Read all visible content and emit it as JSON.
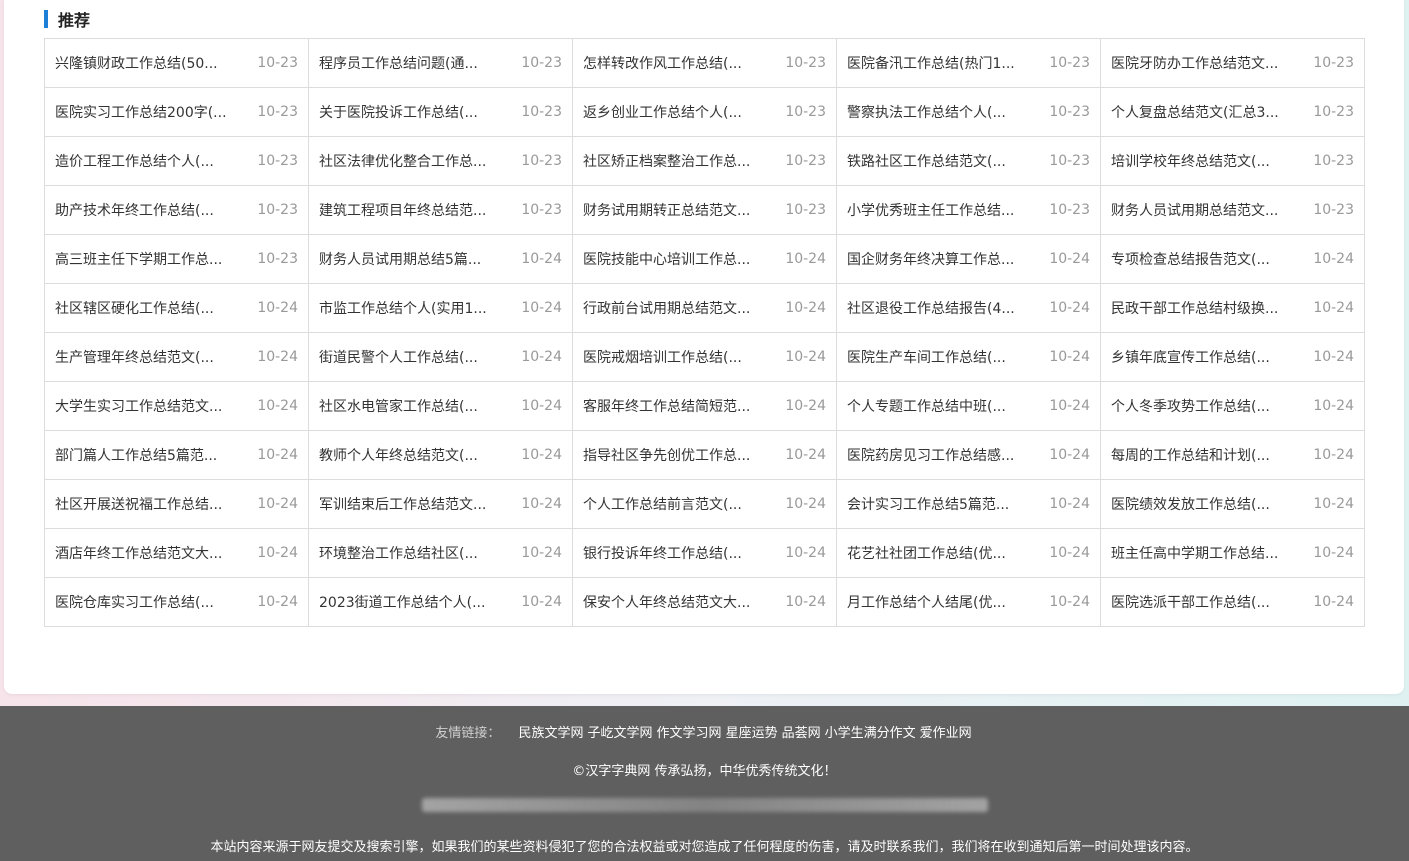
{
  "section": {
    "title": "推荐"
  },
  "articles": [
    {
      "title": "兴隆镇财政工作总结(50...",
      "date": "10-23"
    },
    {
      "title": "程序员工作总结问题(通...",
      "date": "10-23"
    },
    {
      "title": "怎样转改作风工作总结(...",
      "date": "10-23"
    },
    {
      "title": "医院备汛工作总结(热门1...",
      "date": "10-23"
    },
    {
      "title": "医院牙防办工作总结范文...",
      "date": "10-23"
    },
    {
      "title": "医院实习工作总结200字(...",
      "date": "10-23"
    },
    {
      "title": "关于医院投诉工作总结(...",
      "date": "10-23"
    },
    {
      "title": "返乡创业工作总结个人(...",
      "date": "10-23"
    },
    {
      "title": "警察执法工作总结个人(...",
      "date": "10-23"
    },
    {
      "title": "个人复盘总结范文(汇总3...",
      "date": "10-23"
    },
    {
      "title": "造价工程工作总结个人(...",
      "date": "10-23"
    },
    {
      "title": "社区法律优化整合工作总...",
      "date": "10-23"
    },
    {
      "title": "社区矫正档案整治工作总...",
      "date": "10-23"
    },
    {
      "title": "铁路社区工作总结范文(...",
      "date": "10-23"
    },
    {
      "title": "培训学校年终总结范文(...",
      "date": "10-23"
    },
    {
      "title": "助产技术年终工作总结(...",
      "date": "10-23"
    },
    {
      "title": "建筑工程项目年终总结范...",
      "date": "10-23"
    },
    {
      "title": "财务试用期转正总结范文...",
      "date": "10-23"
    },
    {
      "title": "小学优秀班主任工作总结...",
      "date": "10-23"
    },
    {
      "title": "财务人员试用期总结范文...",
      "date": "10-23"
    },
    {
      "title": "高三班主任下学期工作总...",
      "date": "10-23"
    },
    {
      "title": "财务人员试用期总结5篇...",
      "date": "10-24"
    },
    {
      "title": "医院技能中心培训工作总...",
      "date": "10-24"
    },
    {
      "title": "国企财务年终决算工作总...",
      "date": "10-24"
    },
    {
      "title": "专项检查总结报告范文(...",
      "date": "10-24"
    },
    {
      "title": "社区辖区硬化工作总结(...",
      "date": "10-24"
    },
    {
      "title": "市监工作总结个人(实用1...",
      "date": "10-24"
    },
    {
      "title": "行政前台试用期总结范文...",
      "date": "10-24"
    },
    {
      "title": "社区退役工作总结报告(4...",
      "date": "10-24"
    },
    {
      "title": "民政干部工作总结村级换...",
      "date": "10-24"
    },
    {
      "title": "生产管理年终总结范文(...",
      "date": "10-24"
    },
    {
      "title": "街道民警个人工作总结(...",
      "date": "10-24"
    },
    {
      "title": "医院戒烟培训工作总结(...",
      "date": "10-24"
    },
    {
      "title": "医院生产车间工作总结(...",
      "date": "10-24"
    },
    {
      "title": "乡镇年底宣传工作总结(...",
      "date": "10-24"
    },
    {
      "title": "大学生实习工作总结范文...",
      "date": "10-24"
    },
    {
      "title": "社区水电管家工作总结(...",
      "date": "10-24"
    },
    {
      "title": "客服年终工作总结简短范...",
      "date": "10-24"
    },
    {
      "title": "个人专题工作总结中班(...",
      "date": "10-24"
    },
    {
      "title": "个人冬季攻势工作总结(...",
      "date": "10-24"
    },
    {
      "title": "部门篇人工作总结5篇范...",
      "date": "10-24"
    },
    {
      "title": "教师个人年终总结范文(...",
      "date": "10-24"
    },
    {
      "title": "指导社区争先创优工作总...",
      "date": "10-24"
    },
    {
      "title": "医院药房见习工作总结感...",
      "date": "10-24"
    },
    {
      "title": "每周的工作总结和计划(...",
      "date": "10-24"
    },
    {
      "title": "社区开展送祝福工作总结...",
      "date": "10-24"
    },
    {
      "title": "军训结束后工作总结范文...",
      "date": "10-24"
    },
    {
      "title": "个人工作总结前言范文(...",
      "date": "10-24"
    },
    {
      "title": "会计实习工作总结5篇范...",
      "date": "10-24"
    },
    {
      "title": "医院绩效发放工作总结(...",
      "date": "10-24"
    },
    {
      "title": "酒店年终工作总结范文大...",
      "date": "10-24"
    },
    {
      "title": "环境整治工作总结社区(...",
      "date": "10-24"
    },
    {
      "title": "银行投诉年终工作总结(...",
      "date": "10-24"
    },
    {
      "title": "花艺社社团工作总结(优...",
      "date": "10-24"
    },
    {
      "title": "班主任高中学期工作总结...",
      "date": "10-24"
    },
    {
      "title": "医院仓库实习工作总结(...",
      "date": "10-24"
    },
    {
      "title": "2023街道工作总结个人(...",
      "date": "10-24"
    },
    {
      "title": "保安个人年终总结范文大...",
      "date": "10-24"
    },
    {
      "title": "月工作总结个人结尾(优...",
      "date": "10-24"
    },
    {
      "title": "医院选派干部工作总结(...",
      "date": "10-24"
    }
  ],
  "footer": {
    "links_label": "友情链接：",
    "links": [
      "民族文学网",
      "子屹文学网",
      "作文学习网",
      "星座运势",
      "品荟网",
      "小学生满分作文",
      "爱作业网"
    ],
    "copyright": "©汉字字典网 传承弘扬，中华优秀传统文化！",
    "disclaimer": "本站内容来源于网友提交及搜索引擎，如果我们的某些资料侵犯了您的合法权益或对您造成了任何程度的伤害，请及时联系我们，我们将在收到通知后第一时间处理该内容。"
  },
  "colors": {
    "accent": "#1e7fd6",
    "footer_bg": "#5f5f5f",
    "date_text": "#999999"
  }
}
